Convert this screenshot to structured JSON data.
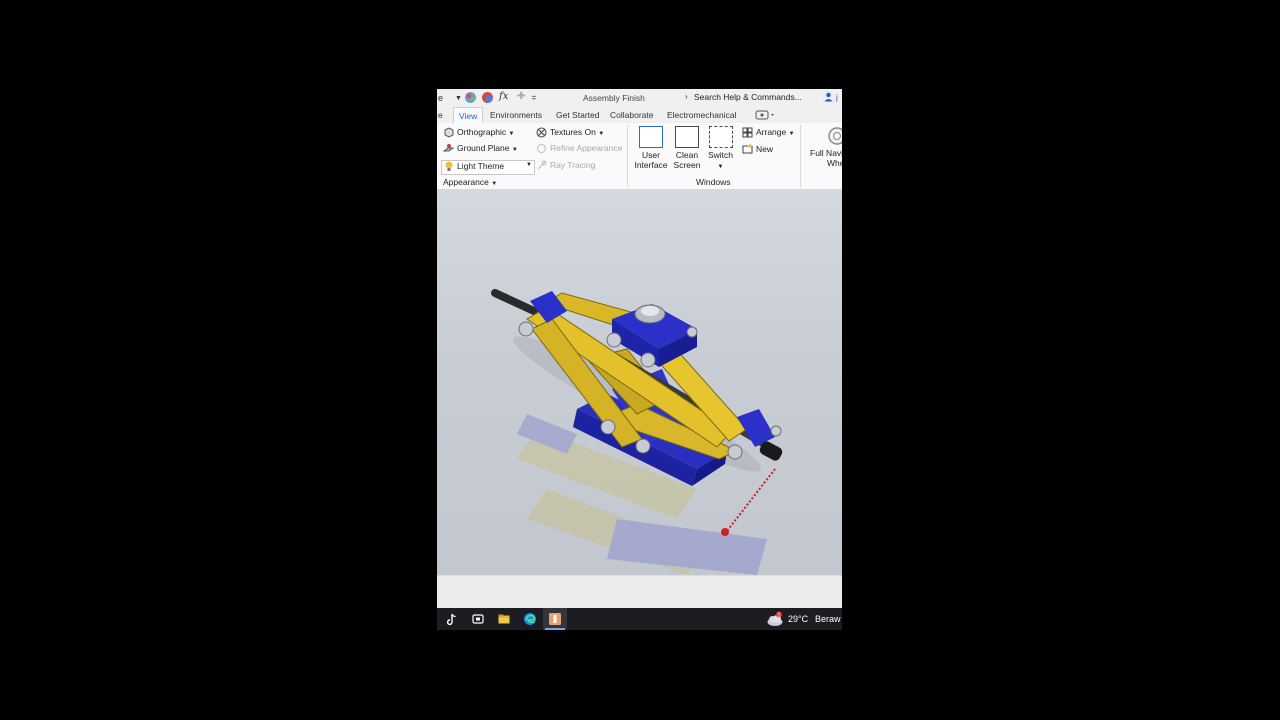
{
  "titlebar": {
    "fx": "fx",
    "doc_title": "Assembly Finish",
    "search": "Search Help & Commands...",
    "user_initial": "j"
  },
  "tabs": {
    "partial": "e",
    "view": "View",
    "environments": "Environments",
    "get_started": "Get Started",
    "collaborate": "Collaborate",
    "electromechanical": "Electromechanical"
  },
  "ribbon": {
    "orthographic": "Orthographic",
    "ground_plane": "Ground Plane",
    "light_theme": "Light Theme",
    "textures_on": "Textures On",
    "refine_appearance": "Refine Appearance",
    "ray_tracing": "Ray Tracing",
    "appearance_panel": "Appearance",
    "user_interface_1": "User",
    "user_interface_2": "Interface",
    "clean_screen_1": "Clean",
    "clean_screen_2": "Screen",
    "switch": "Switch",
    "arrange": "Arrange",
    "new": "New",
    "windows_panel": "Windows",
    "full_nav_1": "Full Navi",
    "full_nav_2": "Whe"
  },
  "taskbar": {
    "temperature": "29°C",
    "weather": "Beraw",
    "notification_count": "1"
  },
  "colors": {
    "accent": "#1e64c8",
    "jack_blue": "#2430c8",
    "jack_yellow": "#e0c020",
    "taskbar": "#1c1c22"
  }
}
